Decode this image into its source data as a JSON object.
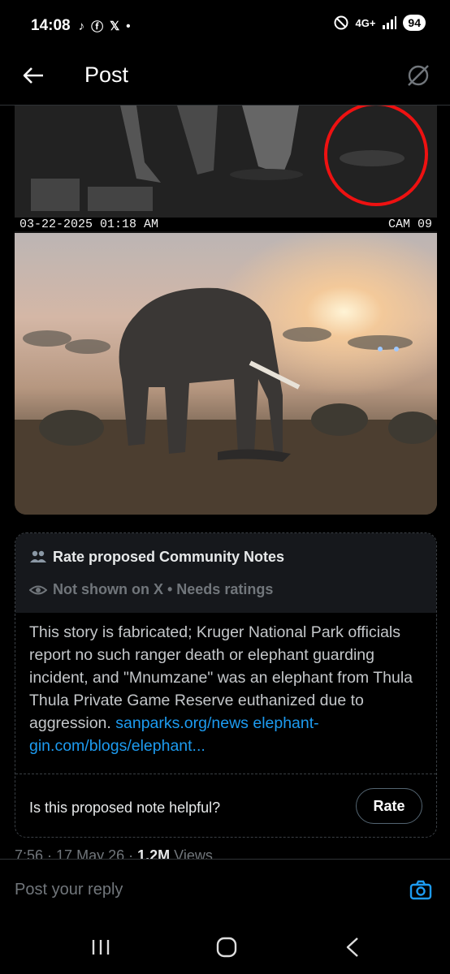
{
  "status_bar": {
    "time": "14:08",
    "network": "4G+",
    "battery": "94"
  },
  "header": {
    "title": "Post"
  },
  "media": {
    "cam_timestamp": "03-22-2025 01:18 AM",
    "cam_label": "CAM 09"
  },
  "community_note": {
    "title": "Rate proposed Community Notes",
    "status": "Not shown on X • Needs ratings",
    "body": "This story is fabricated; Kruger National Park officials report no such ranger death or elephant guarding incident, and \"Mnumzane\" was an elephant from Thula Thula Private Game Reserve euthanized due to aggression.",
    "link_1": "sanparks.org/news",
    "link_2": "elephant-gin.com/blogs/elephant...",
    "question": "Is this proposed note helpful?",
    "rate_label": "Rate"
  },
  "post_meta": {
    "time": "7:56",
    "date": "17 May 26",
    "views_count": "1.2M",
    "views_label": "Views"
  },
  "reply": {
    "placeholder": "Post your reply"
  },
  "colors": {
    "accent": "#1d9bf0",
    "muted": "#71767b",
    "background": "#000000"
  }
}
